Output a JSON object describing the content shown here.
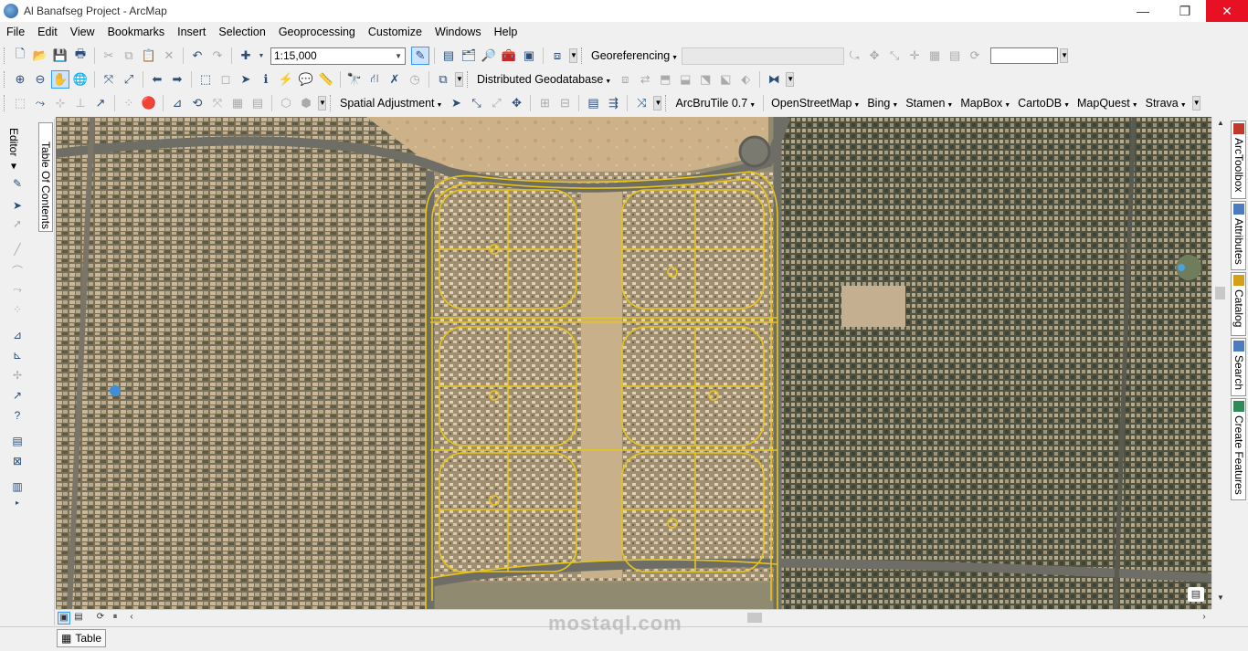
{
  "window": {
    "title": "Al Banafseg Project - ArcMap",
    "minimize": "—",
    "maximize": "❐",
    "close": "✕"
  },
  "menu": [
    "File",
    "Edit",
    "View",
    "Bookmarks",
    "Insert",
    "Selection",
    "Geoprocessing",
    "Customize",
    "Windows",
    "Help"
  ],
  "toolbar1": {
    "scale": "1:15,000",
    "georeferencing": "Georeferencing"
  },
  "toolbar2": {
    "distributed_geodatabase": "Distributed Geodatabase"
  },
  "toolbar3": {
    "spatial_adjustment": "Spatial Adjustment",
    "arcbrutile": "ArcBruTile 0.7",
    "providers": [
      "OpenStreetMap",
      "Bing",
      "Stamen",
      "MapBox",
      "CartoDB",
      "MapQuest",
      "Strava"
    ]
  },
  "left_dock": {
    "editor_label": "Editor",
    "toc_label": "Table Of Contents"
  },
  "right_dock": [
    "ArcToolbox",
    "Attributes",
    "Catalog",
    "Search",
    "Create Features"
  ],
  "status": {
    "table_label": "Table"
  },
  "watermark": "mostaql.com",
  "colors": {
    "road_yellow": "#e8c51a",
    "map_base": "#8f8a70",
    "close_red": "#e81123"
  },
  "icons": {
    "app": "arcmap-globe-icon",
    "table": "table-icon"
  }
}
